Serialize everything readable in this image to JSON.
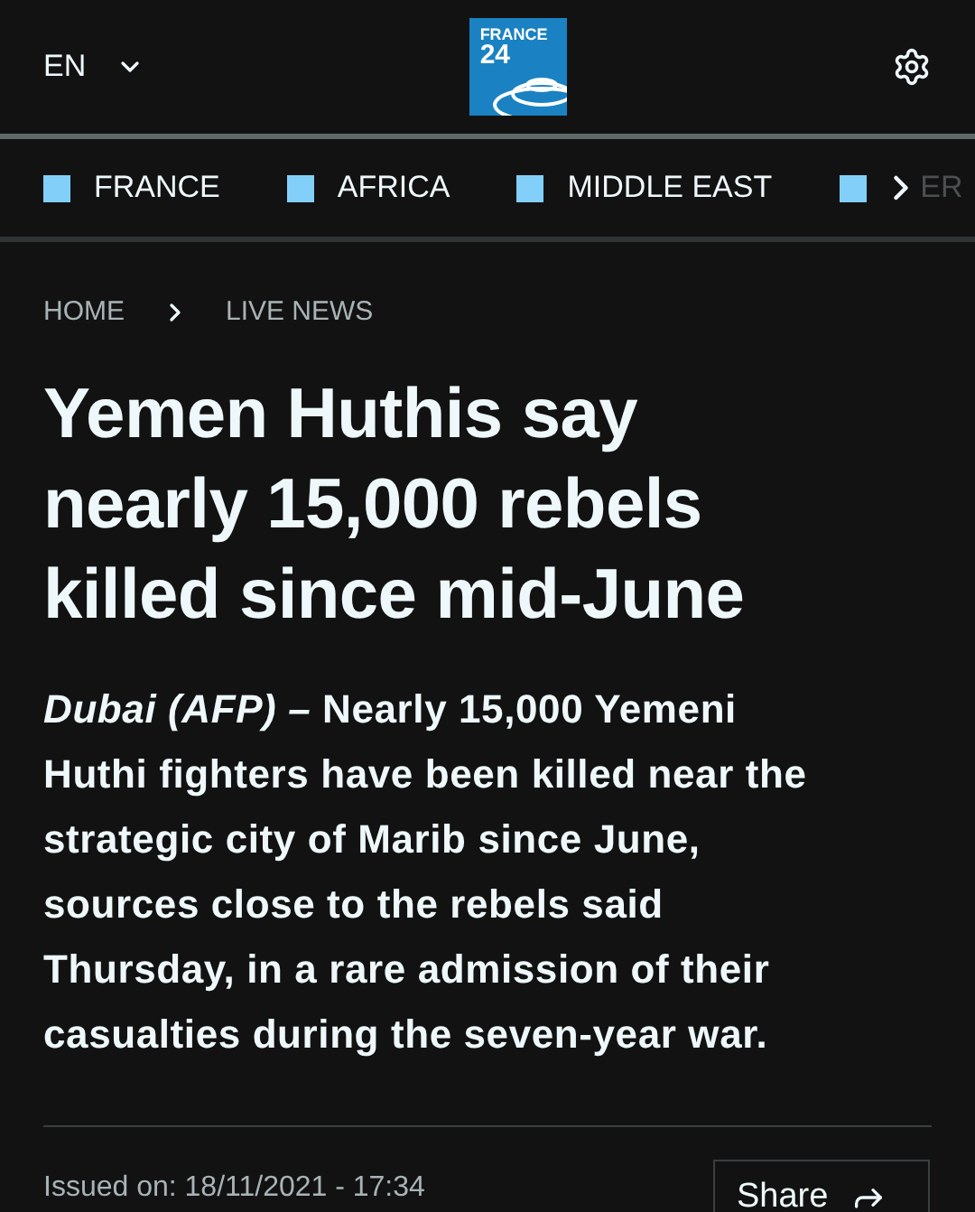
{
  "header": {
    "language": "EN",
    "logo": {
      "line1": "FRANCE",
      "line2": "24"
    }
  },
  "nav": {
    "items": [
      {
        "label": "FRANCE",
        "color": "#82d0fa"
      },
      {
        "label": "AFRICA",
        "color": "#82d0fa"
      },
      {
        "label": "MIDDLE EAST",
        "color": "#82d0fa"
      },
      {
        "label": "ER",
        "color": "#82d0fa"
      }
    ]
  },
  "breadcrumb": [
    "HOME",
    "LIVE NEWS"
  ],
  "article": {
    "title": "Yemen Huthis say nearly 15,000 rebels killed since mid-June",
    "lead": "*Dubai (AFP) –* Nearly 15,000 Yemeni Huthi fighters have been killed near the strategic city of Marib since June, sources close to the rebels said Thursday, in a rare admission of their casualties during the seven-year war.",
    "issued": "Issued on: 18/11/2021 - 17:34",
    "share": "Share"
  }
}
